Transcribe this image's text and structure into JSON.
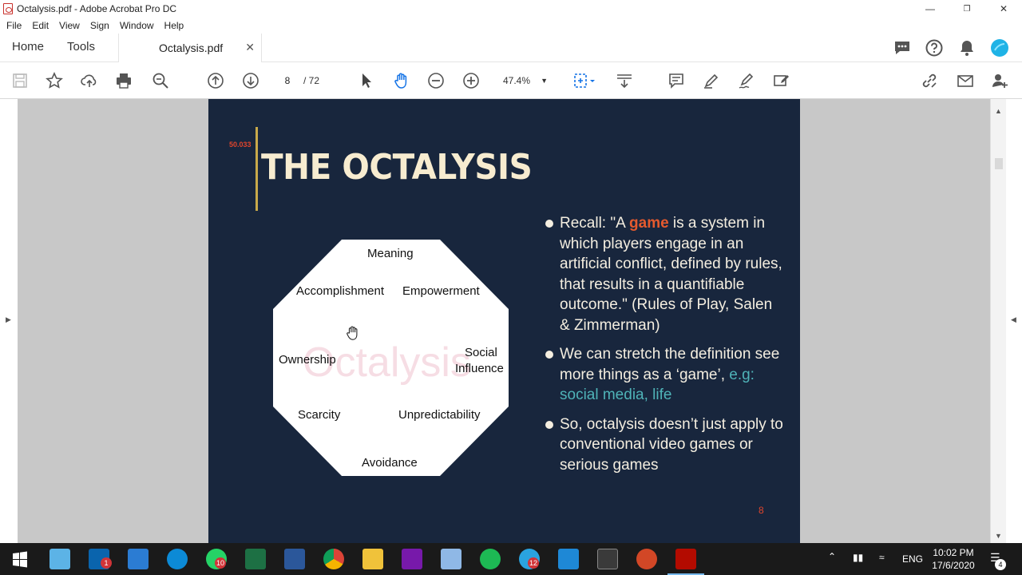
{
  "window": {
    "title": "Octalysis.pdf - Adobe Acrobat Pro DC",
    "minimize": "—",
    "restore": "❐",
    "close": "✕"
  },
  "menu": [
    "File",
    "Edit",
    "View",
    "Sign",
    "Window",
    "Help"
  ],
  "tabs": {
    "home": "Home",
    "tools": "Tools",
    "document": "Octalysis.pdf",
    "document_close": "✕"
  },
  "toolbar": {
    "page_current": "8",
    "page_total": "/  72",
    "zoom": "47.4%"
  },
  "slide": {
    "timestamp": "50.033",
    "title": "THE OCTALYSIS",
    "octagon_labels": {
      "meaning": "Meaning",
      "accomplishment": "Accomplishment",
      "empowerment": "Empowerment",
      "ownership": "Ownership",
      "social_1": "Social",
      "social_2": "Influence",
      "scarcity": "Scarcity",
      "unpredictability": "Unpredictability",
      "avoidance": "Avoidance"
    },
    "watermark": "Octalysis",
    "bullet1_pre": "Recall: \"A ",
    "bullet1_hl": "game",
    "bullet1_post": " is a system in which players engage in an artificial conflict, defined by rules, that results in a quantifiable outcome.\" (Rules of Play, Salen & Zimmerman)",
    "bullet2_pre": "We can stretch the definition see more things as a ‘game’, ",
    "bullet2_hl": "e.g: social media, life",
    "bullet3": "So, octalysis doesn’t just apply to conventional video games or serious games",
    "page_number": "8"
  },
  "taskbar": {
    "badges": {
      "mail": "1",
      "whatsapp": "10",
      "telegram": "12"
    },
    "tray_lang": "ENG",
    "time": "10:02 PM",
    "date": "17/6/2020",
    "notif_count": "4"
  },
  "colors": {
    "slide_bg": "#18263d",
    "title": "#f7ecd0",
    "accent_red": "#e55a2e",
    "accent_teal": "#4fb3b8",
    "gold_bar": "#c8a94a"
  }
}
